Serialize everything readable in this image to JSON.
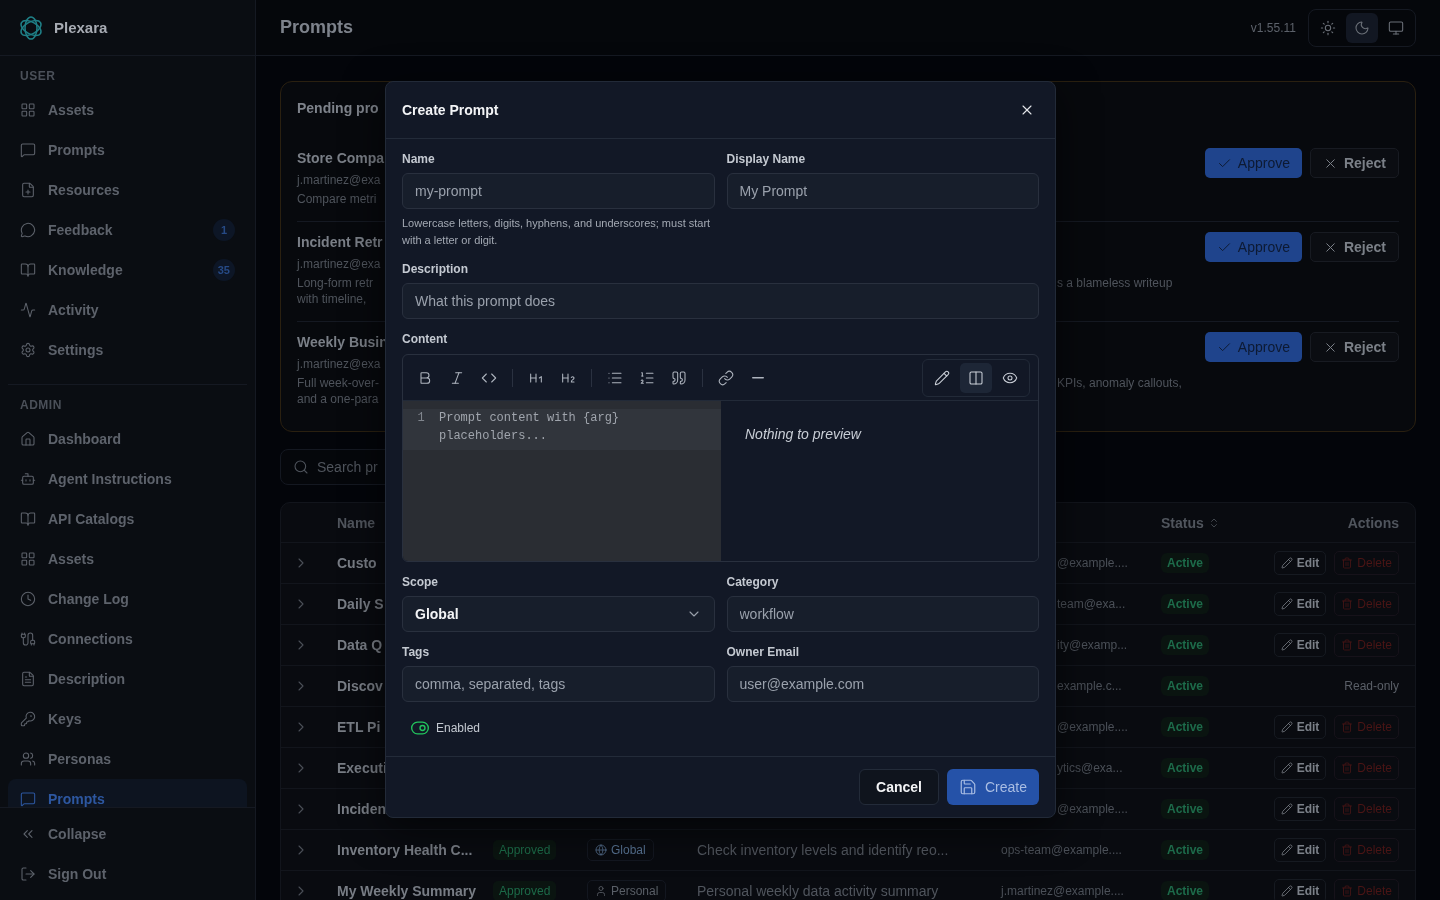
{
  "app": {
    "name": "Plexara"
  },
  "sidebar": {
    "sections": [
      {
        "title": "USER",
        "items": [
          {
            "label": "Assets",
            "selected": false
          },
          {
            "label": "Prompts",
            "selected": false
          },
          {
            "label": "Resources",
            "selected": false
          },
          {
            "label": "Feedback",
            "selected": false,
            "badge": "1"
          },
          {
            "label": "Knowledge",
            "selected": false,
            "badge": "35"
          },
          {
            "label": "Activity",
            "selected": false
          },
          {
            "label": "Settings",
            "selected": false
          }
        ]
      },
      {
        "title": "ADMIN",
        "items": [
          {
            "label": "Dashboard",
            "selected": false
          },
          {
            "label": "Agent Instructions",
            "selected": false
          },
          {
            "label": "API Catalogs",
            "selected": false
          },
          {
            "label": "Assets",
            "selected": false
          },
          {
            "label": "Change Log",
            "selected": false
          },
          {
            "label": "Connections",
            "selected": false
          },
          {
            "label": "Description",
            "selected": false
          },
          {
            "label": "Keys",
            "selected": false
          },
          {
            "label": "Personas",
            "selected": false
          },
          {
            "label": "Prompts",
            "selected": true
          }
        ]
      }
    ],
    "footer": [
      "Collapse",
      "Sign Out"
    ]
  },
  "header": {
    "title": "Prompts",
    "version": "v1.55.11",
    "themes": [
      {
        "selected": false
      },
      {
        "selected": true
      },
      {
        "selected": false
      }
    ]
  },
  "pending": {
    "title": "Pending pro",
    "items": [
      {
        "title": "Store Compa",
        "email": "j.martinez@exa",
        "description": [
          "Compare metri"
        ],
        "approve": "Approve",
        "reject": "Reject"
      },
      {
        "title": "Incident Retr",
        "email": "j.martinez@exa",
        "description": [
          "Long-form retr",
          "with timeline,"
        ],
        "description_tail": "s a blameless writeup",
        "approve": "Approve",
        "reject": "Reject"
      },
      {
        "title": "Weekly Busin",
        "email": "j.martinez@exa",
        "description": [
          "Full week-over-",
          "and a one-para"
        ],
        "description_tail": "KPIs, anomaly callouts,",
        "approve": "Approve",
        "reject": "Reject"
      }
    ]
  },
  "search": {
    "placeholder": "Search pr"
  },
  "table": {
    "columns": [
      "Name",
      "Status",
      "Actions"
    ],
    "rows": [
      {
        "kind": "partial",
        "name": "Custo",
        "owner": "@example....",
        "status": "Active",
        "actions": {
          "kind": "editable",
          "edit": "Edit",
          "delete": "Delete"
        }
      },
      {
        "kind": "partial",
        "name": "Daily S",
        "owner": "team@exa...",
        "status": "Active",
        "actions": {
          "kind": "editable",
          "edit": "Edit",
          "delete": "Delete"
        }
      },
      {
        "kind": "partial",
        "name": "Data Q",
        "owner": "ity@examp...",
        "status": "Active",
        "actions": {
          "kind": "editable",
          "edit": "Edit",
          "delete": "Delete"
        }
      },
      {
        "kind": "partial",
        "name": "Discov",
        "owner": "example.c...",
        "status": "Active",
        "actions": {
          "kind": "readonly",
          "text": "Read-only"
        }
      },
      {
        "kind": "partial",
        "name": "ETL Pi",
        "owner": "@example....",
        "status": "Active",
        "actions": {
          "kind": "editable",
          "edit": "Edit",
          "delete": "Delete"
        }
      },
      {
        "kind": "partial",
        "name": "Executi",
        "owner": "ytics@exa...",
        "status": "Active",
        "actions": {
          "kind": "editable",
          "edit": "Edit",
          "delete": "Delete"
        }
      },
      {
        "kind": "partial",
        "name": "Inciden",
        "owner": "@example....",
        "status": "Active",
        "actions": {
          "kind": "editable",
          "edit": "Edit",
          "delete": "Delete"
        }
      },
      {
        "kind": "full",
        "name": "Inventory Health C...",
        "approval": "Approved",
        "scope": {
          "kind": "global",
          "label": "Global"
        },
        "description": "Check inventory levels and identify reo...",
        "owner": "ops-team@example....",
        "status": "Active",
        "actions": {
          "kind": "editable",
          "edit": "Edit",
          "delete": "Delete"
        }
      },
      {
        "kind": "full",
        "name": "My Weekly Summary",
        "approval": "Approved",
        "scope": {
          "kind": "personal",
          "label": "Personal"
        },
        "description": "Personal weekly data activity summary",
        "owner": "j.martinez@example....",
        "status": "Active",
        "actions": {
          "kind": "editable",
          "edit": "Edit",
          "delete": "Delete"
        }
      }
    ]
  },
  "dialog": {
    "title": "Create Prompt",
    "name": {
      "label": "Name",
      "placeholder": "my-prompt",
      "hint": "Lowercase letters, digits, hyphens, and underscores; must start with a letter or digit."
    },
    "display_name": {
      "label": "Display Name",
      "placeholder": "My Prompt"
    },
    "description": {
      "label": "Description",
      "placeholder": "What this prompt does"
    },
    "content": {
      "label": "Content",
      "line_number": "1",
      "placeholder": "Prompt content with {arg} placeholders...",
      "preview": "Nothing to preview",
      "views": [
        {
          "selected": false
        },
        {
          "selected": true
        },
        {
          "selected": false
        }
      ]
    },
    "scope": {
      "label": "Scope",
      "value": "Global"
    },
    "category": {
      "label": "Category",
      "placeholder": "workflow"
    },
    "tags": {
      "label": "Tags",
      "placeholder": "comma, separated, tags"
    },
    "owner_email": {
      "label": "Owner Email",
      "placeholder": "user@example.com"
    },
    "enabled": {
      "label": "Enabled",
      "on": true
    },
    "cancel": "Cancel",
    "create": "Create"
  }
}
